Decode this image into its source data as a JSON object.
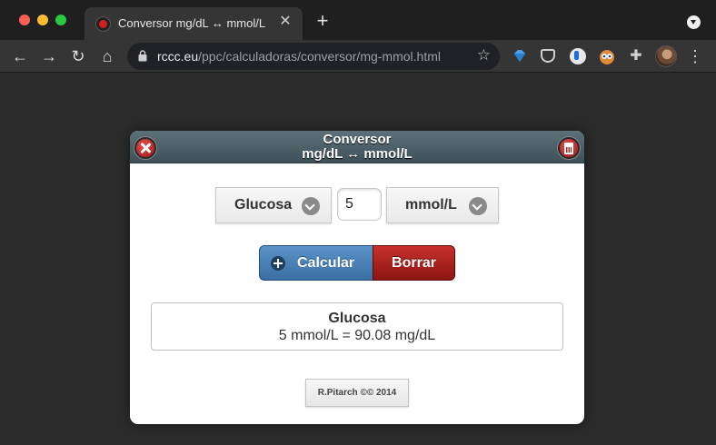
{
  "browser": {
    "tab_title": "Conversor mg/dL ↔ mmol/L",
    "url_host": "rccc.eu",
    "url_path": "/ppc/calculadoras/conversor/mg-mmol.html"
  },
  "dialog": {
    "title_line1": "Conversor",
    "title_line2": "mg/dL ↔ mmol/L",
    "substance_select": "Glucosa",
    "value": "5",
    "unit_select": "mmol/L",
    "calc_button": "Calcular",
    "clear_button": "Borrar",
    "result_title": "Glucosa",
    "result_text": "5 mmol/L = 90.08 mg/dL",
    "credit": "R.Pitarch ©© 2014"
  },
  "colors": {
    "header": "#4e6168",
    "calc_button": "#3b6fa3",
    "clear_button": "#a82220"
  }
}
